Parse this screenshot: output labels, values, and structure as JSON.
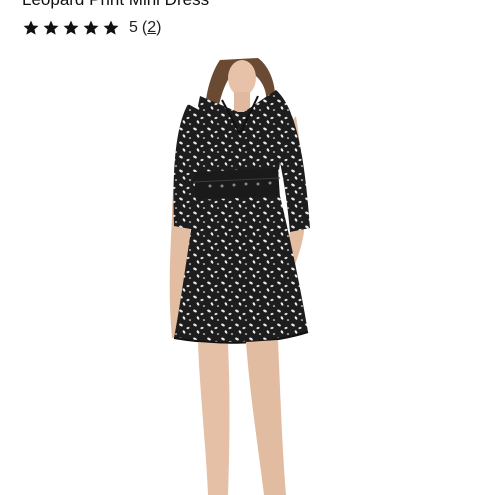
{
  "product": {
    "title": "Leopard Print Mini Dress",
    "rating_value": "5",
    "review_count": "2",
    "stars_filled": 5,
    "stars_total": 5,
    "image_icon": "product-photo"
  },
  "colors": {
    "star": "#111111",
    "text": "#111111"
  }
}
